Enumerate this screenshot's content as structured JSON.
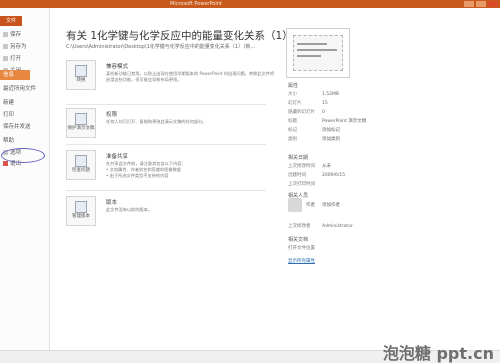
{
  "titlebar": {
    "title": "Microsoft PowerPoint"
  },
  "nav": {
    "file_tab": "文件",
    "items": [
      {
        "label": "保存"
      },
      {
        "label": "另存为"
      },
      {
        "label": "打开"
      },
      {
        "label": "关闭"
      },
      {
        "label": "信息"
      },
      {
        "label": "最近所用文件"
      },
      {
        "label": "新建"
      },
      {
        "label": "打印"
      },
      {
        "label": "保存并发送"
      },
      {
        "label": "帮助"
      },
      {
        "label": "选项"
      },
      {
        "label": "退出"
      }
    ]
  },
  "doc": {
    "title": "有关 1化学键与化学反应中的能量变化关系（1）（新...",
    "path": "C:\\Users\\Administrator\\Desktop\\1化学键与化学反应中的能量变化关系（1）（新..."
  },
  "sections": [
    {
      "button": "转换",
      "head": "兼容模式",
      "text": "某些新功能已禁用，以防止出现在使用早期版本的 PowerPoint 时出现问题。转换此文件将启用这些功能，但可能会导致布局更改。"
    },
    {
      "button": "保护演示文稿",
      "head": "权限",
      "text": "任何人均可打开、复制和更改此演示文稿的任何部分。"
    },
    {
      "button": "检查问题",
      "head": "准备共享",
      "text": "在共享此文件前，请注意其包含以下内容：\n• 文档属性、作者姓名和剪裁的图像数据\n• 由于所选文件类型不支持的内容"
    },
    {
      "button": "管理版本",
      "head": "版本",
      "text": "此文件没有以前的版本。"
    }
  ],
  "properties": {
    "head": "属性",
    "rows": [
      {
        "k": "大小",
        "v": "1.52MB"
      },
      {
        "k": "幻灯片",
        "v": "15"
      },
      {
        "k": "隐藏的幻灯片",
        "v": "0"
      },
      {
        "k": "标题",
        "v": "PowerPoint 演示文稿"
      },
      {
        "k": "标记",
        "v": "添加标记"
      },
      {
        "k": "类别",
        "v": "添加类别"
      }
    ],
    "dates_head": "相关日期",
    "dates": [
      {
        "k": "上次修改时间",
        "v": "从未"
      },
      {
        "k": "创建时间",
        "v": "2009/6/15"
      },
      {
        "k": "上次打印时间",
        "v": ""
      }
    ],
    "people_head": "相关人员",
    "author_label": "作者",
    "author": "添加作者",
    "last_modified_label": "上次修改者",
    "last_modified": "Administrator",
    "docs_head": "相关文档",
    "open_location": "打开文件位置",
    "show_all": "显示所有属性"
  },
  "watermark": "泡泡糖 ppt.cn"
}
